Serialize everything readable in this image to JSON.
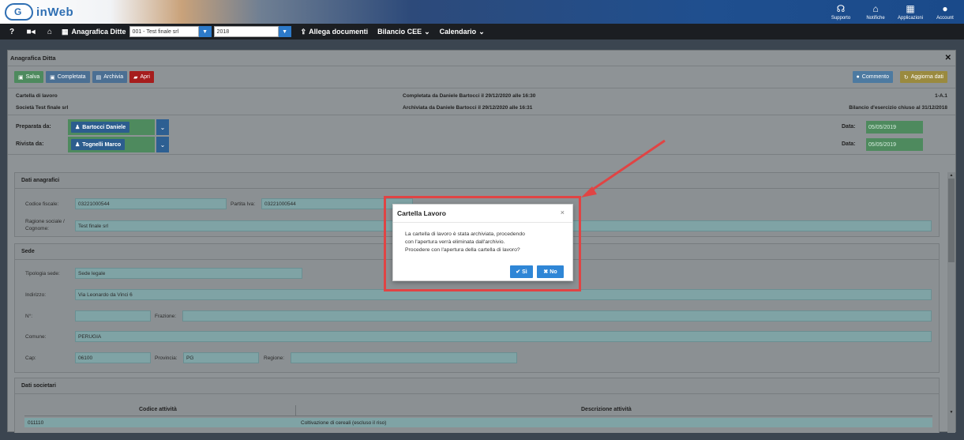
{
  "app": {
    "name": "inWeb",
    "logo_letter": "G"
  },
  "top_actions": [
    {
      "label": "Supporto",
      "icon": "headset-icon",
      "glyph": "☊"
    },
    {
      "label": "Notifiche",
      "icon": "bell-icon",
      "glyph": "🔔"
    },
    {
      "label": "Applicazioni",
      "icon": "grid-icon",
      "glyph": "▦"
    },
    {
      "label": "Account",
      "icon": "user-icon",
      "glyph": "●"
    }
  ],
  "navbar": {
    "help": "?",
    "video": "■◂",
    "home": "⌂",
    "ditte_label": "Anagrafica Ditte",
    "company_select": "001 - Test finale srl",
    "year_select": "2018",
    "allega": "Allega documenti",
    "bilancio": "Bilancio CEE",
    "calendario": "Calendario"
  },
  "panel": {
    "title": "Anagrafica Ditta",
    "toolbar": {
      "salva": "Salva",
      "completata": "Completata",
      "archivia": "Archivia",
      "apri": "Apri",
      "commento": "Commento",
      "aggiorna": "Aggiorna dati"
    },
    "info": {
      "left1": "Cartella di lavoro",
      "left2": "Società Test finale srl",
      "mid1": "Completata da Daniele Bartocci il 29/12/2020 alle 16:30",
      "mid2": "Archiviata da Daniele Bartocci il 29/12/2020 alle 16:31",
      "right1": "1-A.1",
      "right2": "Bilancio d'esercizio chiuso al 31/12/2018"
    },
    "review": {
      "preparata_label": "Preparata da:",
      "preparata_user": "Bartocci Daniele",
      "rivista_label": "Rivista da:",
      "rivista_user": "Tognelli Marco",
      "data_label": "Data:",
      "data1": "05/05/2019",
      "data2": "05/05/2019"
    },
    "anagrafici": {
      "title": "Dati anagrafici",
      "cf_label": "Codice fiscale:",
      "cf_value": "03221000544",
      "piva_label": "Partita Iva:",
      "piva_value": "03221000544",
      "rs_label1": "Ragione sociale /",
      "rs_label2": "Cognome:",
      "rs_value": "Test finale srl"
    },
    "sede": {
      "title": "Sede",
      "tipologia_label": "Tipologia sede:",
      "tipologia_value": "Sede legale",
      "indirizzo_label": "Indirizzo:",
      "indirizzo_value": "Via Leonardo da Vinci 6",
      "numero_label": "N°:",
      "numero_value": "",
      "frazione_label": "Frazione:",
      "frazione_value": "",
      "comune_label": "Comune:",
      "comune_value": "PERUGIA",
      "cap_label": "Cap:",
      "cap_value": "06100",
      "provincia_label": "Provincia:",
      "provincia_value": "PG",
      "regione_label": "Regione:",
      "regione_value": ""
    },
    "societari": {
      "title": "Dati societari",
      "col1": "Codice attività",
      "col2": "Descrizione attività",
      "row_code": "011110",
      "row_desc": "Coltivazione di cereali (escluso il riso)"
    }
  },
  "modal": {
    "title": "Cartella Lavoro",
    "close": "×",
    "line1": "La cartella di lavoro è stata archiviata, procedendo",
    "line2": "con l'apertura verrà eliminata dall'archivio.",
    "line3": "Procedere con l'apertura della cartella di lavoro?",
    "yes": "Sì",
    "no": "No"
  },
  "colors": {
    "highlight": "#e04444",
    "primary": "#2f86d6"
  }
}
